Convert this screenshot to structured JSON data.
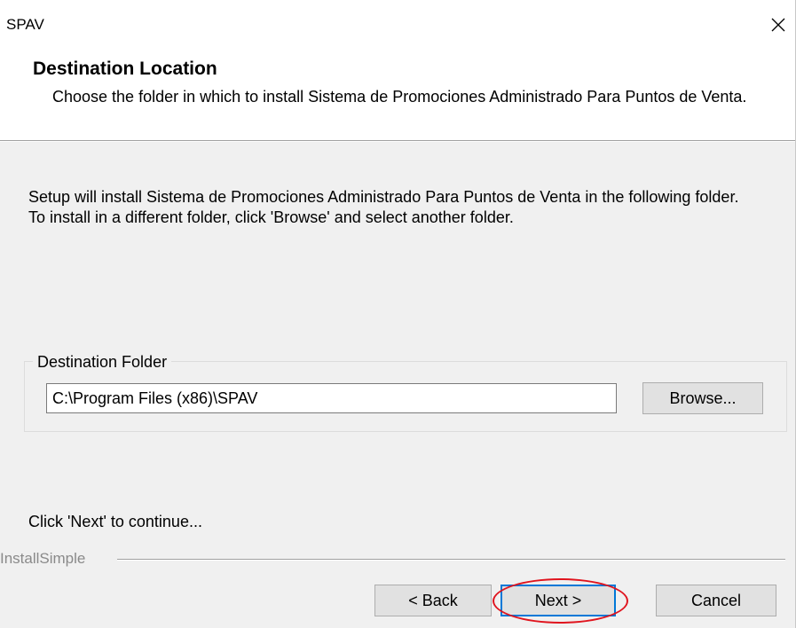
{
  "window": {
    "title": "SPAV"
  },
  "header": {
    "title": "Destination Location",
    "description": "Choose the folder in which to install Sistema de Promociones Administrado Para Puntos de Venta."
  },
  "body": {
    "info_line1": "Setup will install Sistema de Promociones Administrado Para Puntos de Venta in the following folder.",
    "info_line2": "To install in a different folder, click 'Browse' and select another folder.",
    "continue_text": "Click 'Next' to continue..."
  },
  "destination": {
    "group_label": "Destination Folder",
    "path": "C:\\Program Files (x86)\\SPAV",
    "browse_label": "Browse..."
  },
  "footer": {
    "brand": "InstallSimple",
    "back_label": "< Back",
    "next_label": "Next >",
    "cancel_label": "Cancel"
  },
  "colors": {
    "highlight": "#e0141e",
    "focus": "#0078d7"
  },
  "icons": {
    "close": "close-icon"
  }
}
